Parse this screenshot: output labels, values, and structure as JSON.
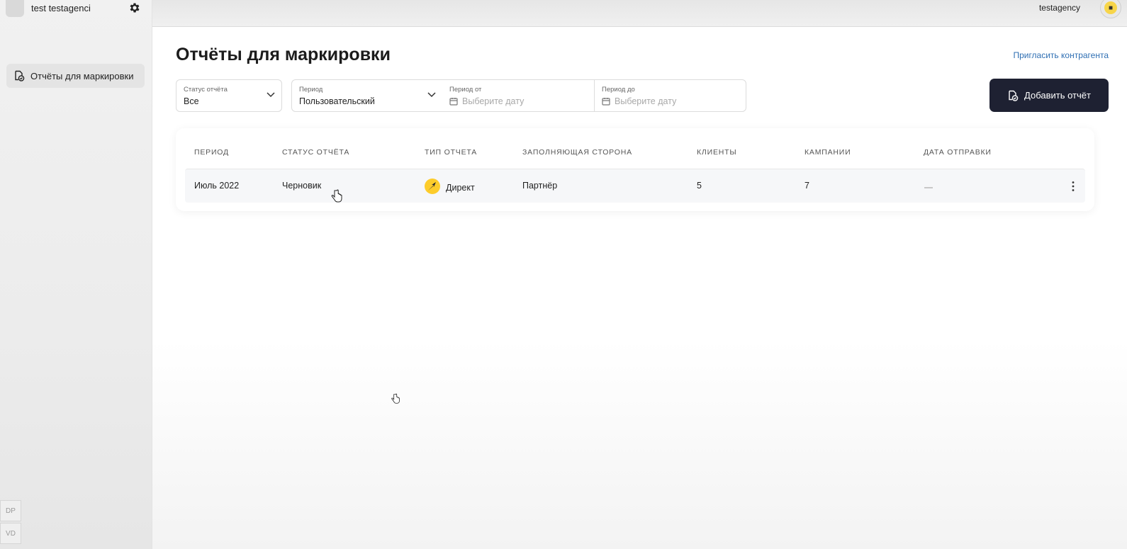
{
  "sidebar": {
    "org_name": "test testagenci",
    "nav_items": [
      {
        "label": "Отчёты для маркировки",
        "icon": "report-icon"
      }
    ],
    "bottom_buttons": [
      "DP",
      "VD"
    ]
  },
  "topbar": {
    "username": "testagency",
    "avatar_icon": "user-avatar-icon"
  },
  "main": {
    "title": "Отчёты для маркировки",
    "invite_link": "Пригласить контрагента",
    "add_button": "Добавить отчёт",
    "filters": {
      "status": {
        "label": "Статус отчёта",
        "value": "Все"
      },
      "period": {
        "label": "Период",
        "value": "Пользовательский"
      },
      "period_from": {
        "label": "Период от",
        "placeholder": "Выберите дату"
      },
      "period_to": {
        "label": "Период до",
        "placeholder": "Выберите дату"
      }
    },
    "table": {
      "headers": [
        "ПЕРИОД",
        "СТАТУС ОТЧЁТА",
        "ТИП ОТЧЕТА",
        "ЗАПОЛНЯЮЩАЯ СТОРОНА",
        "КЛИЕНТЫ",
        "КАМПАНИИ",
        "ДАТА ОТПРАВКИ"
      ],
      "rows": [
        {
          "period": "Июль 2022",
          "status": "Черновик",
          "type": "Директ",
          "filler": "Партнёр",
          "clients": "5",
          "campaigns": "7",
          "sent_date": ""
        }
      ]
    }
  },
  "colors": {
    "primary_button": "#1e2132",
    "link": "#2f6fb3",
    "direct_logo_bg": "#fdcc2b",
    "direct_logo_arrow": "#1e2132"
  }
}
